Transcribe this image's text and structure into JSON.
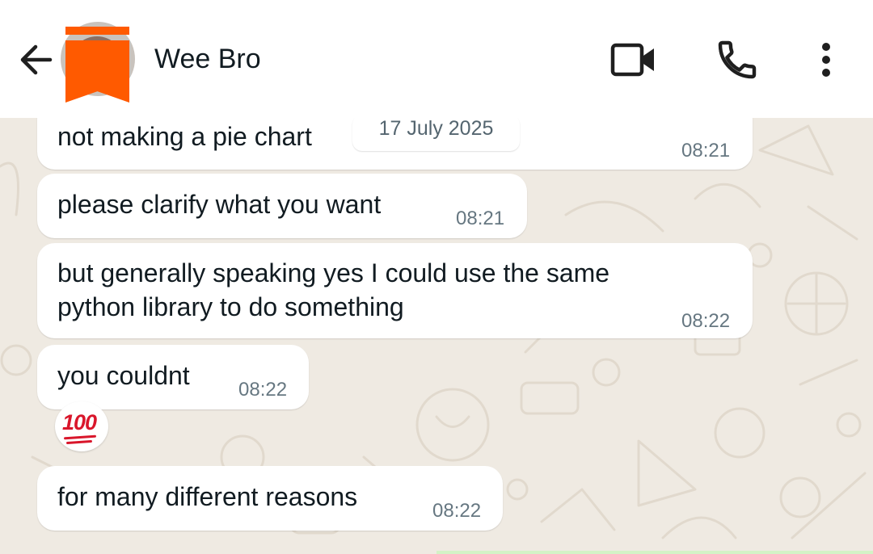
{
  "header": {
    "contact_name": "Wee Bro",
    "back_icon": "arrow-left-icon",
    "video_icon": "video-camera-icon",
    "call_icon": "phone-icon",
    "menu_icon": "more-vertical-icon"
  },
  "date_chip": "17 July 2025",
  "messages": [
    {
      "text": "not making a pie chart",
      "time": "08:21"
    },
    {
      "text": "please clarify what you want",
      "time": "08:21"
    },
    {
      "text": "but generally speaking yes I could use the same\npython library to do something",
      "time": "08:22"
    },
    {
      "text": "you couldnt",
      "time": "08:22"
    },
    {
      "text": "for many different reasons",
      "time": "08:22"
    }
  ],
  "reaction": {
    "emoji": "💯",
    "icon": "hundred-points-icon"
  },
  "colors": {
    "header_bg": "#ffffff",
    "chat_bg": "#efeae2",
    "bubble_in": "#ffffff",
    "timestamp": "#667781",
    "redaction": "#ff5a00"
  }
}
